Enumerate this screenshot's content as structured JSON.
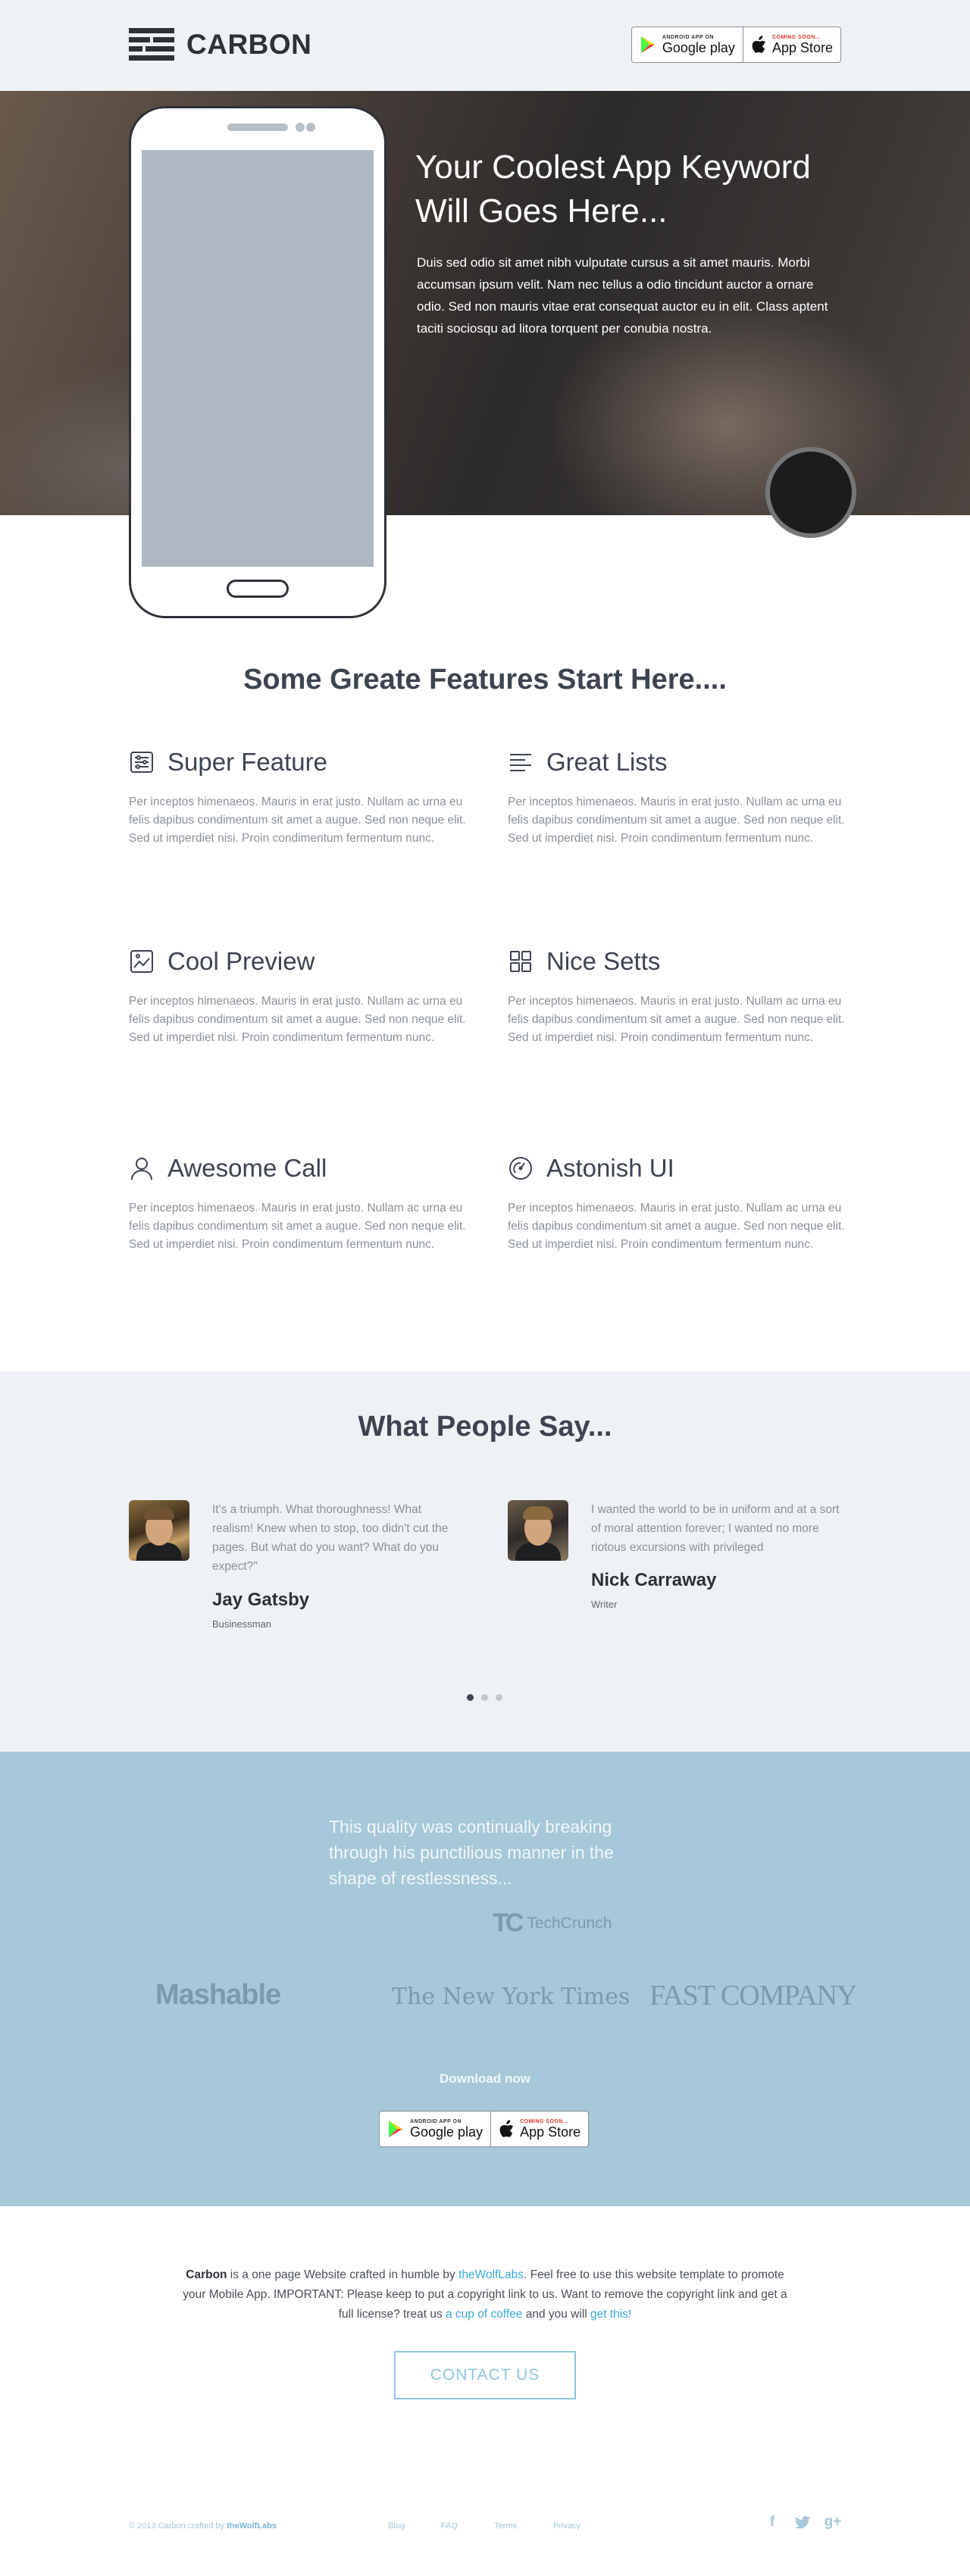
{
  "header": {
    "brand": "CARBON",
    "google_badge": {
      "small": "ANDROID APP ON",
      "big": "Google play"
    },
    "apple_badge": {
      "small": "COMING SOON...",
      "big": "App Store"
    }
  },
  "hero": {
    "title": "Your Coolest App Keyword Will Goes Here...",
    "text": "Duis sed odio sit amet nibh vulputate cursus a sit amet mauris. Morbi accumsan ipsum velit. Nam nec tellus a odio tincidunt auctor a ornare odio. Sed non  mauris vitae erat consequat auctor eu in elit. Class aptent taciti sociosqu ad litora torquent per conubia nostra."
  },
  "features": {
    "title": "Some Greate Features Start Here....",
    "items": [
      {
        "icon": "sliders-icon",
        "title": "Super Feature",
        "text": "Per inceptos himenaeos. Mauris in erat justo. Nullam ac urna eu felis dapibus condimentum sit amet a augue. Sed non neque elit. Sed ut imperdiet nisi. Proin condimentum fermentum nunc."
      },
      {
        "icon": "list-icon",
        "title": "Great Lists",
        "text": "Per inceptos himenaeos. Mauris in erat justo. Nullam ac urna eu felis dapibus condimentum sit amet a augue. Sed non neque elit. Sed ut imperdiet nisi. Proin condimentum fermentum nunc."
      },
      {
        "icon": "image-icon",
        "title": "Cool Preview",
        "text": "Per inceptos himenaeos. Mauris in erat justo. Nullam ac urna eu felis dapibus condimentum sit amet a augue. Sed non neque elit. Sed ut imperdiet nisi. Proin condimentum fermentum nunc."
      },
      {
        "icon": "grid-icon",
        "title": "Nice Setts",
        "text": "Per inceptos himenaeos. Mauris in erat justo. Nullam ac urna eu felis dapibus condimentum sit amet a augue. Sed non neque elit. Sed ut imperdiet nisi. Proin condimentum fermentum nunc."
      },
      {
        "icon": "user-icon",
        "title": "Awesome Call",
        "text": "Per inceptos himenaeos. Mauris in erat justo. Nullam ac urna eu felis dapibus condimentum sit amet a augue. Sed non neque elit. Sed ut imperdiet nisi. Proin condimentum fermentum nunc."
      },
      {
        "icon": "gauge-icon",
        "title": "Astonish UI",
        "text": "Per inceptos himenaeos. Mauris in erat justo. Nullam ac urna eu felis dapibus condimentum sit amet a augue. Sed non neque elit. Sed ut imperdiet nisi. Proin condimentum fermentum nunc."
      }
    ]
  },
  "testimonials": {
    "title": "What People Say...",
    "items": [
      {
        "quote": "It's a triumph. What thoroughness! What realism! Knew when to stop, too didn't cut the pages. But what do you want? What do you expect?\"",
        "name": "Jay Gatsby",
        "role": "Businessman"
      },
      {
        "quote": "I wanted the world to be in uniform and at a sort of moral attention forever; I wanted no more riotous excursions with privileged",
        "name": "Nick Carraway",
        "role": "Writer"
      }
    ],
    "active_slide": 1,
    "slide_count": 3
  },
  "press": {
    "quote": "This quality was continually breaking through his punctilious manner in the shape of restlessness...",
    "quote_source": "TechCrunch",
    "quote_source_mark": "TC",
    "logos": [
      "Mashable",
      "The New York Times",
      "FAST COMPANY"
    ],
    "download_label": "Download now",
    "google_badge": {
      "small": "ANDROID APP ON",
      "big": "Google play"
    },
    "apple_badge": {
      "small": "COMING SOON...",
      "big": "App Store"
    }
  },
  "footer": {
    "brand": "Carbon",
    "text_1": " is a one page Website crafted in humble by ",
    "author_link": "theWolfLabs",
    "text_2": ". Feel free to use this website template to promote your Mobile App. IMPORTANT: Please keep to put a copyright link to us. Want to remove the copyright link and get a full license? treat us ",
    "coffee_link": "a cup of coffee",
    "text_3": " and you will ",
    "this_link": "get this!",
    "contact_label": "CONTACT US",
    "copyright": "© 2013 Carbon crafted by ",
    "copyright_credit": "theWolfLabs",
    "nav": [
      "Blog",
      "FAQ",
      "Terms",
      "Privacy"
    ],
    "social": [
      {
        "icon": "facebook-icon",
        "glyph": "f"
      },
      {
        "icon": "twitter-icon",
        "glyph": "t"
      },
      {
        "icon": "google-plus-icon",
        "glyph": "g+"
      }
    ]
  },
  "colors": {
    "dark": "#2e3138",
    "light_bg": "#eef2f5",
    "press_bg": "#a6c8d8",
    "accent_link": "#3aa8d8"
  }
}
